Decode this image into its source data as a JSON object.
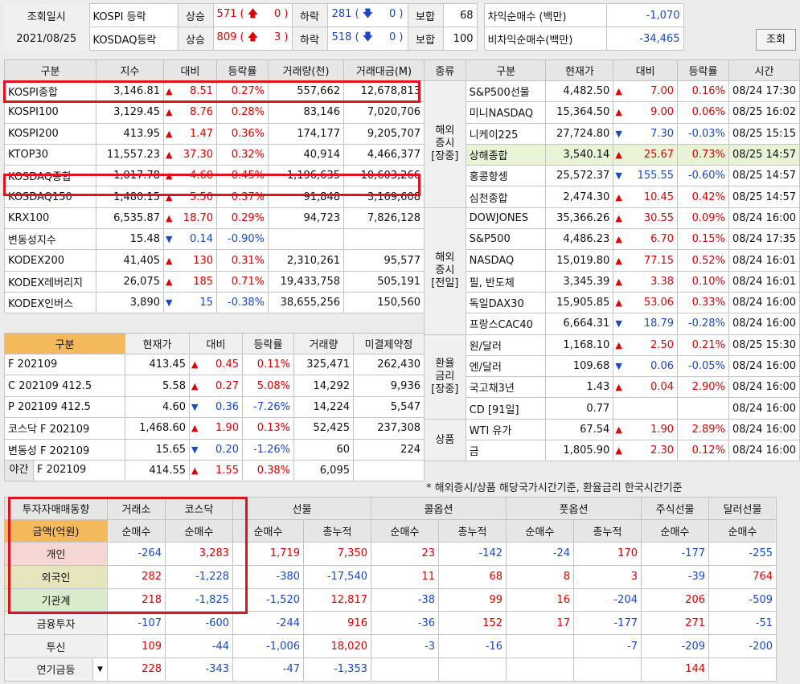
{
  "top": {
    "date_label": "조회일시",
    "date_value": "2021/08/25",
    "rows": [
      {
        "name": "KOSPI 등락",
        "rise_label": "상승",
        "rise_total": "571",
        "rise_limit": "0",
        "fall_label": "하락",
        "fall_total": "281",
        "fall_limit": "0",
        "flat_label": "보합",
        "flat": "68"
      },
      {
        "name": "KOSDAQ등락",
        "rise_label": "상승",
        "rise_total": "809",
        "rise_limit": "3",
        "fall_label": "하락",
        "fall_total": "518",
        "fall_limit": "0",
        "flat_label": "보합",
        "flat": "100"
      }
    ],
    "arb": [
      {
        "label": "차익순매수 (백만)",
        "value": "-1,070"
      },
      {
        "label": "비차익순매수(백만)",
        "value": "-34,465"
      }
    ],
    "query_button": "조회"
  },
  "index_table": {
    "headers": [
      "구분",
      "지수",
      "대비",
      "등락률",
      "거래량(천)",
      "거래대금(M)"
    ],
    "rows": [
      {
        "name": "KOSPI종합",
        "index": "3,146.81",
        "dir": "up",
        "change": "8.51",
        "rate": "0.27%",
        "volume": "557,662",
        "amount": "12,678,813"
      },
      {
        "name": "KOSPI100",
        "index": "3,129.45",
        "dir": "up",
        "change": "8.76",
        "rate": "0.28%",
        "volume": "83,146",
        "amount": "7,020,706"
      },
      {
        "name": "KOSPI200",
        "index": "413.95",
        "dir": "up",
        "change": "1.47",
        "rate": "0.36%",
        "volume": "174,177",
        "amount": "9,205,707"
      },
      {
        "name": "KTOP30",
        "index": "11,557.23",
        "dir": "up",
        "change": "37.30",
        "rate": "0.32%",
        "volume": "40,914",
        "amount": "4,466,377"
      },
      {
        "name": "KOSDAQ종합",
        "index": "1,017.78",
        "dir": "up",
        "change": "4.60",
        "rate": "0.45%",
        "volume": "1,196,635",
        "amount": "10,603,266"
      },
      {
        "name": "KOSDAQ150",
        "index": "1,480.15",
        "dir": "up",
        "change": "5.50",
        "rate": "0.37%",
        "volume": "91,848",
        "amount": "3,169,608"
      },
      {
        "name": "KRX100",
        "index": "6,535.87",
        "dir": "up",
        "change": "18.70",
        "rate": "0.29%",
        "volume": "94,723",
        "amount": "7,826,128"
      },
      {
        "name": "변동성지수",
        "index": "15.48",
        "dir": "dn",
        "change": "0.14",
        "rate": "-0.90%",
        "volume": "",
        "amount": ""
      },
      {
        "name": "KODEX200",
        "index": "41,405",
        "dir": "up",
        "change": "130",
        "rate": "0.31%",
        "volume": "2,310,261",
        "amount": "95,577"
      },
      {
        "name": "KODEX레버리지",
        "index": "26,075",
        "dir": "up",
        "change": "185",
        "rate": "0.71%",
        "volume": "19,433,758",
        "amount": "505,191"
      },
      {
        "name": "KODEX인버스",
        "index": "3,890",
        "dir": "dn",
        "change": "15",
        "rate": "-0.38%",
        "volume": "38,655,256",
        "amount": "150,560"
      }
    ]
  },
  "futures_table": {
    "headers": [
      "구분",
      "현재가",
      "대비",
      "등락률",
      "거래량",
      "미결제약정"
    ],
    "rows": [
      {
        "name": "F 202109",
        "price": "413.45",
        "dir": "up",
        "change": "0.45",
        "rate": "0.11%",
        "volume": "325,471",
        "oi": "262,430"
      },
      {
        "name": "C 202109 412.5",
        "price": "5.58",
        "dir": "up",
        "change": "0.27",
        "rate": "5.08%",
        "volume": "14,292",
        "oi": "9,936"
      },
      {
        "name": "P 202109 412.5",
        "price": "4.60",
        "dir": "dn",
        "change": "0.36",
        "rate": "-7.26%",
        "volume": "14,224",
        "oi": "5,547"
      },
      {
        "name": "코스닥 F 202109",
        "price": "1,468.60",
        "dir": "up",
        "change": "1.90",
        "rate": "0.13%",
        "volume": "52,425",
        "oi": "237,308"
      },
      {
        "name": "변동성 F 202109",
        "price": "15.65",
        "dir": "dn",
        "change": "0.20",
        "rate": "-1.26%",
        "volume": "60",
        "oi": "224"
      }
    ],
    "night": {
      "tag": "야간",
      "name": "F 202109",
      "price": "414.55",
      "dir": "up",
      "change": "1.55",
      "rate": "0.38%",
      "volume": "6,095",
      "oi": ""
    }
  },
  "world_table": {
    "headers": [
      "종류",
      "구분",
      "현재가",
      "대비",
      "등락률",
      "시간"
    ],
    "groups": [
      {
        "label": "해외\n증시\n[장중]",
        "rows": [
          {
            "name": "S&P500선물",
            "price": "4,482.50",
            "dir": "up",
            "change": "7.00",
            "rate": "0.16%",
            "time": "08/24 17:30"
          },
          {
            "name": "미니NASDAQ",
            "price": "15,364.50",
            "dir": "up",
            "change": "9.00",
            "rate": "0.06%",
            "time": "08/25 16:02"
          },
          {
            "name": "니케이225",
            "price": "27,724.80",
            "dir": "dn",
            "change": "7.30",
            "rate": "-0.03%",
            "time": "08/25 15:15"
          },
          {
            "name": "상해종합",
            "price": "3,540.14",
            "dir": "up",
            "change": "25.67",
            "rate": "0.73%",
            "time": "08/25 14:57",
            "hl": true
          },
          {
            "name": "홍콩항셍",
            "price": "25,572.37",
            "dir": "dn",
            "change": "155.55",
            "rate": "-0.60%",
            "time": "08/25 14:57"
          },
          {
            "name": "심천종합",
            "price": "2,474.30",
            "dir": "up",
            "change": "10.45",
            "rate": "0.42%",
            "time": "08/25 14:57"
          }
        ]
      },
      {
        "label": "해외\n증시\n[전일]",
        "rows": [
          {
            "name": "DOWJONES",
            "price": "35,366.26",
            "dir": "up",
            "change": "30.55",
            "rate": "0.09%",
            "time": "08/24 16:00"
          },
          {
            "name": "S&P500",
            "price": "4,486.23",
            "dir": "up",
            "change": "6.70",
            "rate": "0.15%",
            "time": "08/24 17:35"
          },
          {
            "name": "NASDAQ",
            "price": "15,019.80",
            "dir": "up",
            "change": "77.15",
            "rate": "0.52%",
            "time": "08/24 16:01"
          },
          {
            "name": "필, 반도체",
            "price": "3,345.39",
            "dir": "up",
            "change": "3.38",
            "rate": "0.10%",
            "time": "08/24 16:01"
          },
          {
            "name": "독일DAX30",
            "price": "15,905.85",
            "dir": "up",
            "change": "53.06",
            "rate": "0.33%",
            "time": "08/24 16:00"
          },
          {
            "name": "프랑스CAC40",
            "price": "6,664.31",
            "dir": "dn",
            "change": "18.79",
            "rate": "-0.28%",
            "time": "08/24 16:00"
          }
        ]
      },
      {
        "label": "환율\n금리\n[장중]",
        "rows": [
          {
            "name": "원/달러",
            "price": "1,168.10",
            "dir": "up",
            "change": "2.50",
            "rate": "0.21%",
            "time": "08/25 15:30"
          },
          {
            "name": "엔/달러",
            "price": "109.68",
            "dir": "dn",
            "change": "0.06",
            "rate": "-0.05%",
            "time": "08/24 16:00"
          },
          {
            "name": "국고채3년",
            "price": "1.43",
            "dir": "up",
            "change": "0.04",
            "rate": "2.90%",
            "time": "08/24 16:00"
          },
          {
            "name": "CD [91일]",
            "price": "0.77",
            "dir": "",
            "change": "",
            "rate": "",
            "time": "08/24 16:00"
          }
        ]
      },
      {
        "label": "상품",
        "rows": [
          {
            "name": "WTI 유가",
            "price": "67.54",
            "dir": "up",
            "change": "1.90",
            "rate": "2.89%",
            "time": "08/24 16:00"
          },
          {
            "name": "금",
            "price": "1,805.90",
            "dir": "up",
            "change": "2.30",
            "rate": "0.12%",
            "time": "08/24 16:00"
          }
        ]
      }
    ],
    "note": "* 해외증시/상품 해당국가시간기준, 환율금리 한국시간기준"
  },
  "investor_table": {
    "title": "투자자매매동향",
    "unit": "금액(억원)",
    "groups": [
      "거래소",
      "코스닥",
      "선물",
      "콜옵션",
      "풋옵션",
      "주식선물",
      "달러선물"
    ],
    "subheaders": [
      "순매수",
      "순매수",
      "순매수",
      "총누적",
      "순매수",
      "총누적",
      "순매수",
      "총누적",
      "순매수",
      "순매수"
    ],
    "rows": [
      {
        "name": "개인",
        "values": [
          "-264",
          "3,283",
          "1,719",
          "7,350",
          "23",
          "-142",
          "-24",
          "170",
          "-177",
          "-255"
        ]
      },
      {
        "name": "외국인",
        "values": [
          "282",
          "-1,228",
          "-380",
          "-17,540",
          "11",
          "68",
          "8",
          "3",
          "-39",
          "764"
        ]
      },
      {
        "name": "기관계",
        "values": [
          "218",
          "-1,825",
          "-1,520",
          "12,817",
          "-38",
          "99",
          "16",
          "-204",
          "206",
          "-509"
        ]
      },
      {
        "name": "금융투자",
        "values": [
          "-107",
          "-600",
          "-244",
          "916",
          "-36",
          "152",
          "17",
          "-177",
          "271",
          "-51"
        ]
      },
      {
        "name": "투신",
        "values": [
          "109",
          "-44",
          "-1,006",
          "18,020",
          "-3",
          "-16",
          "",
          "-7",
          "-209",
          "-200"
        ]
      },
      {
        "name": "연기금등",
        "values": [
          "228",
          "-343",
          "-47",
          "-1,353",
          "",
          "",
          "",
          "",
          "144",
          ""
        ]
      }
    ],
    "last_row_dropdown": true
  },
  "colors": {
    "up": "#e00000",
    "down": "#1a48c8",
    "highlight_box": "#e0141e",
    "orange_header": "#f4b95a"
  }
}
